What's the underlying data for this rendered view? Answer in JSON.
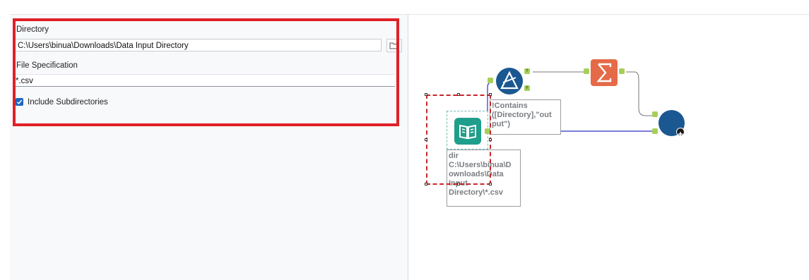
{
  "config": {
    "directory_label": "Directory",
    "directory_value": "C:\\Users\\binua\\Downloads\\Data Input Directory",
    "file_spec_label": "File Specification",
    "file_spec_value": "*.csv",
    "include_subdirs_label": "Include Subdirectories",
    "include_subdirs_checked": true
  },
  "canvas": {
    "filter_annotation": "!Contains\n([Directory],\"out\nput\")",
    "directory_annotation": "dir\nC:\\Users\\binua\\D\nownloads\\Data\nInput\nDirectory\\*.csv",
    "filter_true_port": "T",
    "filter_false_port": "F"
  },
  "colors": {
    "highlight_red": "#e02027",
    "filter_blue": "#1b5891",
    "directory_teal": "#1e9e8b",
    "summarize_orange": "#e56a48",
    "union_blue": "#1b5891",
    "connector_blue": "#2b2fc8",
    "port_green": "#a6cf5a"
  },
  "icons": [
    "folder-browse-icon",
    "checkmark-icon",
    "directory-tool-icon",
    "filter-tool-icon",
    "summarize-tool-icon",
    "union-tool-icon",
    "plus-icon"
  ]
}
